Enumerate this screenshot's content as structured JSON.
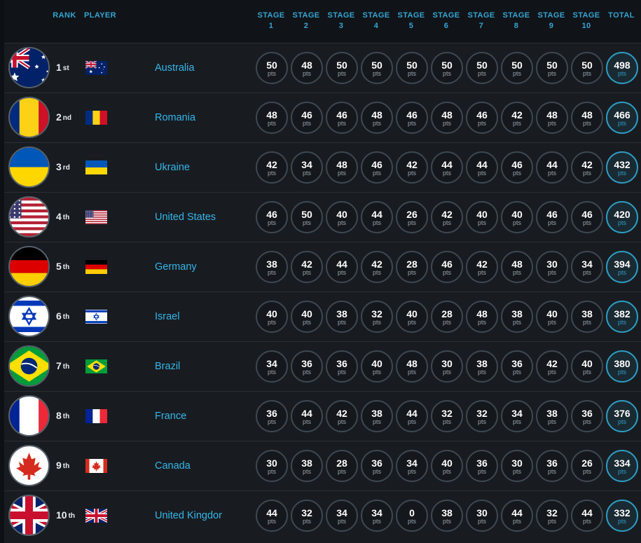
{
  "header": {
    "rank": "RANK",
    "player": "PLAYER",
    "stages": [
      {
        "top": "STAGE",
        "num": "1"
      },
      {
        "top": "STAGE",
        "num": "2"
      },
      {
        "top": "STAGE",
        "num": "3"
      },
      {
        "top": "STAGE",
        "num": "4"
      },
      {
        "top": "STAGE",
        "num": "5"
      },
      {
        "top": "STAGE",
        "num": "6"
      },
      {
        "top": "STAGE",
        "num": "7"
      },
      {
        "top": "STAGE",
        "num": "8"
      },
      {
        "top": "STAGE",
        "num": "9"
      },
      {
        "top": "STAGE",
        "num": "10"
      }
    ],
    "total": "TOTAL"
  },
  "unit": "pts",
  "colors": {
    "accent": "#35a4d2",
    "name": "#35b6e8",
    "background": "#181c21"
  },
  "rows": [
    {
      "rank": "1",
      "suffix": "st",
      "flag": "australia-flag",
      "name": "Australia",
      "scores": [
        "50",
        "48",
        "50",
        "50",
        "50",
        "50",
        "50",
        "50",
        "50",
        "50"
      ],
      "total": "498"
    },
    {
      "rank": "2",
      "suffix": "nd",
      "flag": "romania-flag",
      "name": "Romania",
      "scores": [
        "48",
        "46",
        "46",
        "48",
        "46",
        "48",
        "46",
        "42",
        "48",
        "48"
      ],
      "total": "466"
    },
    {
      "rank": "3",
      "suffix": "rd",
      "flag": "ukraine-flag",
      "name": "Ukraine",
      "scores": [
        "42",
        "34",
        "48",
        "46",
        "42",
        "44",
        "44",
        "46",
        "44",
        "42"
      ],
      "total": "432"
    },
    {
      "rank": "4",
      "suffix": "th",
      "flag": "usa-flag",
      "name": "United States",
      "scores": [
        "46",
        "50",
        "40",
        "44",
        "26",
        "42",
        "40",
        "40",
        "46",
        "46"
      ],
      "total": "420"
    },
    {
      "rank": "5",
      "suffix": "th",
      "flag": "germany-flag",
      "name": "Germany",
      "scores": [
        "38",
        "42",
        "44",
        "42",
        "28",
        "46",
        "42",
        "48",
        "30",
        "34"
      ],
      "total": "394"
    },
    {
      "rank": "6",
      "suffix": "th",
      "flag": "israel-flag",
      "name": "Israel",
      "scores": [
        "40",
        "40",
        "38",
        "32",
        "40",
        "28",
        "48",
        "38",
        "40",
        "38"
      ],
      "total": "382"
    },
    {
      "rank": "7",
      "suffix": "th",
      "flag": "brazil-flag",
      "name": "Brazil",
      "scores": [
        "34",
        "36",
        "36",
        "40",
        "48",
        "30",
        "38",
        "36",
        "42",
        "40"
      ],
      "total": "380"
    },
    {
      "rank": "8",
      "suffix": "th",
      "flag": "france-flag",
      "name": "France",
      "scores": [
        "36",
        "44",
        "42",
        "38",
        "44",
        "32",
        "32",
        "34",
        "38",
        "36"
      ],
      "total": "376"
    },
    {
      "rank": "9",
      "suffix": "th",
      "flag": "canada-flag",
      "name": "Canada",
      "scores": [
        "30",
        "38",
        "28",
        "36",
        "34",
        "40",
        "36",
        "30",
        "36",
        "26"
      ],
      "total": "334"
    },
    {
      "rank": "10",
      "suffix": "th",
      "flag": "uk-flag",
      "name": "United Kingdor",
      "scores": [
        "44",
        "32",
        "34",
        "34",
        "0",
        "38",
        "30",
        "44",
        "32",
        "44"
      ],
      "total": "332"
    }
  ]
}
